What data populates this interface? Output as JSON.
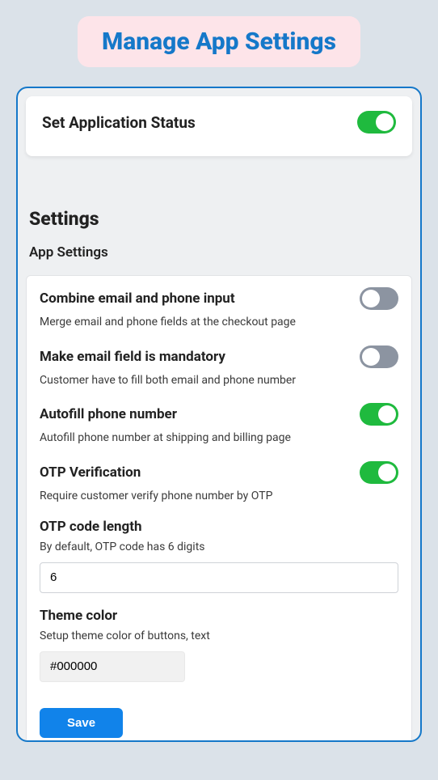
{
  "header": {
    "title": "Manage App Settings"
  },
  "status": {
    "label": "Set Application Status",
    "enabled": true
  },
  "sections": {
    "title": "Settings",
    "subtitle": "App Settings"
  },
  "settings": {
    "combine": {
      "label": "Combine email and phone input",
      "desc": "Merge email and phone fields at the checkout page",
      "enabled": false
    },
    "mandatory": {
      "label": "Make email field is mandatory",
      "desc": "Customer have to fill both email and phone number",
      "enabled": false
    },
    "autofill": {
      "label": "Autofill phone number",
      "desc": "Autofill phone number at shipping and billing page",
      "enabled": true
    },
    "otp": {
      "label": "OTP Verification",
      "desc": "Require customer verify phone number by OTP",
      "enabled": true
    },
    "otplen": {
      "label": "OTP code length",
      "desc": "By default, OTP code has 6 digits",
      "value": "6"
    },
    "theme": {
      "label": "Theme color",
      "desc": "Setup theme color of buttons, text",
      "value": "#000000"
    }
  },
  "buttons": {
    "save": "Save"
  }
}
